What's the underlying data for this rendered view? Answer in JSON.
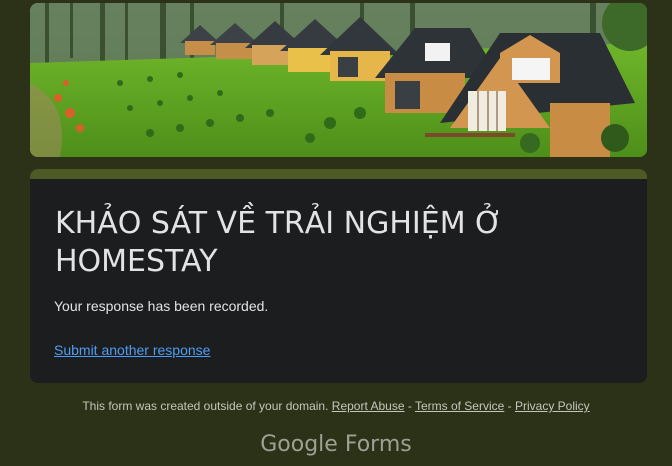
{
  "form": {
    "title": "KHẢO SÁT VỀ TRẢI NGHIỆM Ở HOMESTAY",
    "confirmation_message": "Your response has been recorded.",
    "submit_another_label": "Submit another response"
  },
  "footer": {
    "note_text": "This form was created outside of your domain.",
    "report_abuse_label": "Report Abuse",
    "separator_1": " - ",
    "terms_label": "Terms of Service",
    "separator_2": " - ",
    "privacy_label": "Privacy Policy"
  },
  "brand": {
    "google": "Google",
    "forms": "Forms"
  },
  "colors": {
    "background": "#2b3218",
    "card": "#1c1d1f",
    "accent": "#4d5a26",
    "link": "#4e9df2"
  }
}
